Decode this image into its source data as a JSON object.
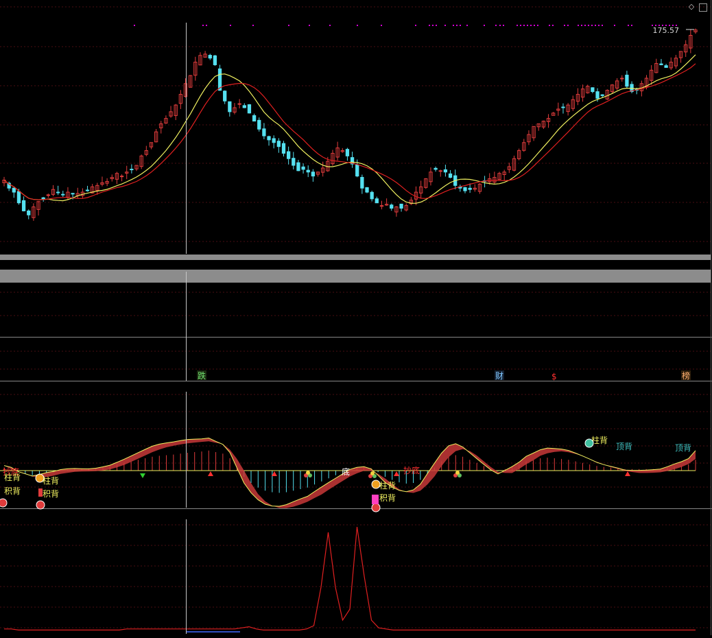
{
  "colors": {
    "background": "#000000",
    "grid": "#4a0e12",
    "up": "#e03c3c",
    "down": "#55e0f0",
    "ma_fast": "#f0f060",
    "ma_slow": "#e02020",
    "separator": "#8c8c8c",
    "dots": "#d400d4",
    "crosshair": "#c8c8c8"
  },
  "window_controls": {
    "diamond_icon": "◇",
    "square_icon": "□"
  },
  "price_label": "175.57",
  "event_labels": {
    "die": "跌",
    "cai": "财",
    "dollar": "$",
    "bang": "榜"
  },
  "signal_labels": {
    "chaodi": "抄底",
    "zhubei": "柱背",
    "jibei": "积背",
    "dingbei": "顶背",
    "di": "底"
  },
  "chart_data": [
    {
      "type": "candlestick",
      "title": "",
      "x": {
        "start_index": 0,
        "end_index": 167
      },
      "ylim": [
        10,
        183
      ],
      "price_label": 175.57,
      "overlays": [
        "ma_fast",
        "ma_slow"
      ],
      "note_series": "closes",
      "closes": [
        64,
        58,
        55,
        47,
        41,
        38,
        44,
        48,
        50,
        53,
        57,
        55,
        53,
        55,
        54,
        54,
        55,
        56,
        59,
        60,
        62,
        63,
        66,
        69,
        67,
        70,
        72,
        75,
        82,
        86,
        92,
        100,
        106,
        110,
        115,
        120,
        128,
        136,
        142,
        152,
        157,
        158,
        155,
        150,
        131,
        123,
        115,
        118,
        121,
        118,
        114,
        108,
        102,
        97,
        94,
        92,
        89,
        84,
        80,
        75,
        71,
        72,
        70,
        67,
        70,
        73,
        78,
        84,
        88,
        86,
        82,
        76,
        67,
        58,
        55,
        50,
        47,
        45,
        46,
        43,
        44,
        43,
        45,
        49,
        55,
        59,
        65,
        70,
        72,
        71,
        70,
        66,
        60,
        58,
        56,
        57,
        58,
        61,
        63,
        65,
        66,
        69,
        70,
        74,
        80,
        86,
        92,
        98,
        104,
        106,
        108,
        110,
        114,
        117,
        118,
        120,
        124,
        128,
        132,
        134,
        130,
        125,
        127,
        131,
        135,
        138,
        140,
        134,
        130,
        131,
        136,
        140,
        146,
        151,
        150,
        148,
        152,
        155,
        160,
        165,
        172,
        176
      ],
      "volatility_band_pct": 4
    },
    {
      "type": "bar",
      "title": "",
      "name": "macd_histogram",
      "ylim": [
        -1,
        1
      ],
      "values": [
        0.1,
        0.05,
        -0.05,
        -0.1,
        -0.15,
        -0.12,
        -0.08,
        -0.05,
        0.0,
        0.03,
        0.05,
        0.06,
        0.07,
        0.09,
        0.12,
        0.15,
        0.2,
        0.25,
        0.3,
        0.35,
        0.4,
        0.45,
        0.48,
        0.5,
        0.52,
        0.55,
        0.58,
        0.6,
        0.62,
        0.65,
        0.6,
        0.55,
        0.4,
        0.1,
        -0.2,
        -0.4,
        -0.55,
        -0.65,
        -0.7,
        -0.72,
        -0.7,
        -0.65,
        -0.6,
        -0.55,
        -0.45,
        -0.35,
        -0.25,
        -0.15,
        -0.05,
        0.05,
        0.1,
        0.12,
        0.08,
        -0.05,
        -0.2,
        -0.3,
        -0.38,
        -0.42,
        -0.4,
        -0.3,
        -0.1,
        0.1,
        0.3,
        0.45,
        0.5,
        0.45,
        0.35,
        0.25,
        0.15,
        0.05,
        -0.02,
        0.05,
        0.12,
        0.2,
        0.3,
        0.35,
        0.4,
        0.42,
        0.4,
        0.38,
        0.35,
        0.3,
        0.25,
        0.2,
        0.15,
        0.12,
        0.1,
        0.08,
        0.05,
        0.05,
        0.05,
        0.05,
        0.05,
        0.05,
        0.08,
        0.12,
        0.15,
        0.2,
        0.35
      ]
    },
    {
      "type": "line",
      "title": "",
      "name": "peak_indicator",
      "ylim": [
        0,
        1
      ],
      "values": [
        0.02,
        0.02,
        0.01,
        0.01,
        0.01,
        0.01,
        0.01,
        0.01,
        0.01,
        0.01,
        0.01,
        0.01,
        0.01,
        0.01,
        0.01,
        0.01,
        0.01,
        0.02,
        0.02,
        0.02,
        0.02,
        0.02,
        0.02,
        0.02,
        0.02,
        0.02,
        0.02,
        0.02,
        0.02,
        0.02,
        0.02,
        0.02,
        0.02,
        0.03,
        0.04,
        0.02,
        0.01,
        0.01,
        0.01,
        0.01,
        0.01,
        0.01,
        0.02,
        0.05,
        0.4,
        0.9,
        0.4,
        0.1,
        0.2,
        0.95,
        0.5,
        0.1,
        0.03,
        0.02,
        0.01,
        0.01,
        0.01,
        0.01,
        0.01,
        0.01,
        0.01,
        0.01,
        0.01,
        0.01,
        0.01,
        0.01,
        0.01,
        0.01,
        0.01,
        0.01,
        0.01,
        0.01,
        0.01,
        0.01,
        0.01,
        0.01,
        0.01,
        0.01,
        0.01,
        0.01,
        0.01,
        0.01,
        0.01,
        0.01,
        0.01,
        0.01,
        0.01,
        0.01,
        0.01,
        0.01,
        0.01,
        0.01,
        0.01,
        0.01,
        0.01,
        0.01,
        0.01
      ]
    }
  ]
}
